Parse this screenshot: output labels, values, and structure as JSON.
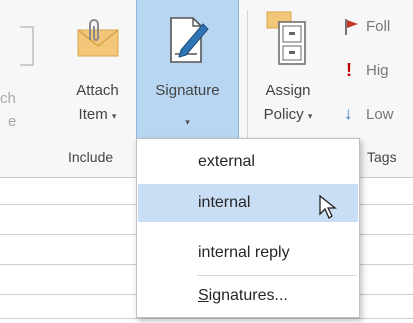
{
  "ribbon": {
    "partial_left_top": "ch",
    "partial_left_bottom": "e",
    "attach_item": {
      "line1": "Attach",
      "line2": "Item",
      "caret": "▾"
    },
    "signature": {
      "label": "Signature",
      "caret": "▾"
    },
    "assign_policy": {
      "line1": "Assign",
      "line2": "Policy",
      "caret": "▾"
    },
    "tags_items": [
      {
        "label": "Foll",
        "icon": "flag-icon",
        "color": "#c0392b"
      },
      {
        "label": "Hig",
        "icon": "high-importance-icon",
        "color": "#c00000"
      },
      {
        "label": "Low",
        "icon": "low-importance-icon",
        "color": "#2e75b6"
      }
    ],
    "group_include": "Include",
    "group_tags": "Tags"
  },
  "signature_menu": {
    "items": [
      {
        "label": "external"
      },
      {
        "label": "internal"
      },
      {
        "label": "internal reply"
      }
    ],
    "manage_label": "Signatures...",
    "manage_underline_char": "S"
  },
  "colors": {
    "accent_selected": "#b8d6f2",
    "hover": "#c9def5"
  }
}
